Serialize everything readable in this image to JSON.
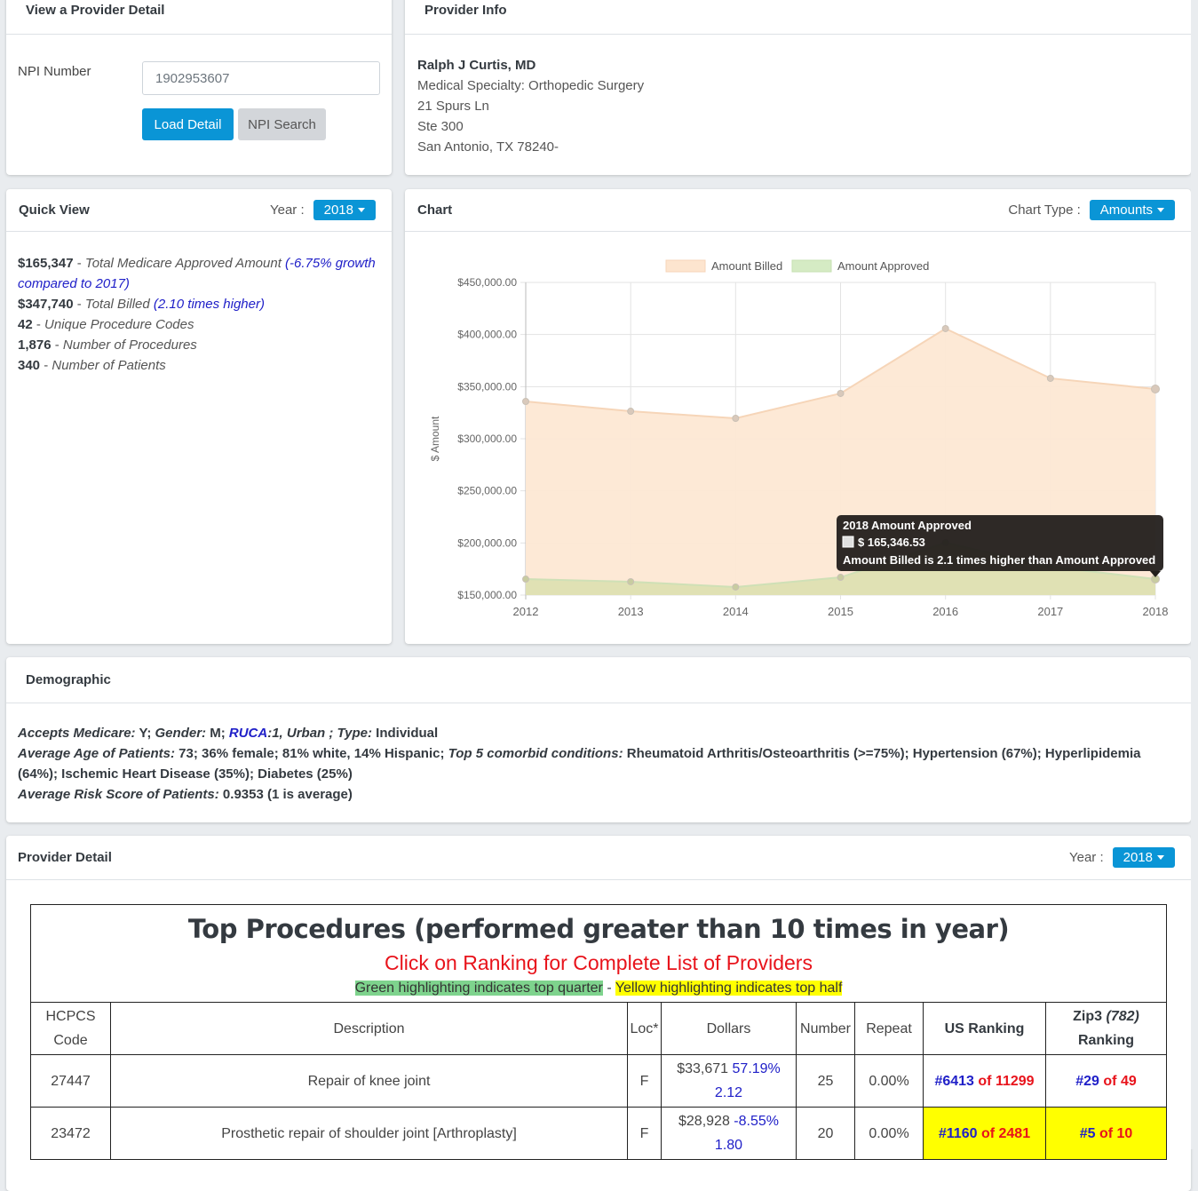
{
  "view_provider": {
    "title": "View a Provider Detail",
    "npi_label": "NPI Number",
    "npi_value": "1902953607",
    "load_button": "Load Detail",
    "npi_search_button": "NPI Search"
  },
  "provider_info": {
    "title": "Provider Info",
    "name": "Ralph J Curtis, MD",
    "specialty": "Medical Specialty: Orthopedic Surgery",
    "address1": "21 Spurs Ln",
    "address2": "Ste 300",
    "city_state_zip": "San Antonio, TX 78240-"
  },
  "quick_view": {
    "title": "Quick View",
    "year_label": "Year :",
    "year_value": "2018",
    "items": [
      {
        "value": "$165,347",
        "sep": " - ",
        "label": "Total Medicare Approved Amount",
        "note": " (-6.75% growth compared to 2017)"
      },
      {
        "value": "$347,740",
        "sep": " - ",
        "label": "Total Billed",
        "note": " (2.10 times higher)"
      },
      {
        "value": "42",
        "sep": " - ",
        "label": "Unique Procedure Codes",
        "note": ""
      },
      {
        "value": "1,876",
        "sep": " - ",
        "label": "Number of Procedures",
        "note": ""
      },
      {
        "value": "340",
        "sep": " - ",
        "label": "Number of Patients",
        "note": ""
      }
    ]
  },
  "chart_card": {
    "title": "Chart",
    "type_label": "Chart Type :",
    "type_value": "Amounts",
    "tooltip": {
      "title": "2018 Amount Approved",
      "value": "$ 165,346.53",
      "footer": "Amount Billed is 2.1 times higher than Amount Approved"
    }
  },
  "chart_data": {
    "type": "area",
    "title": "",
    "xlabel": "",
    "ylabel": "$ Amount",
    "x": [
      "2012",
      "2013",
      "2014",
      "2015",
      "2016",
      "2017",
      "2018"
    ],
    "ylim": [
      150000,
      450000
    ],
    "yticks": [
      150000,
      200000,
      250000,
      300000,
      350000,
      400000,
      450000
    ],
    "ytick_labels": [
      "$150,000.00",
      "$200,000.00",
      "$250,000.00",
      "$300,000.00",
      "$350,000.00",
      "$400,000.00",
      "$450,000.00"
    ],
    "grid": true,
    "legend_position": "top-center",
    "series": [
      {
        "name": "Amount Billed",
        "color": "#fde5cf",
        "values": [
          335800,
          326400,
          319600,
          343500,
          405700,
          358000,
          347740
        ]
      },
      {
        "name": "Amount Approved",
        "color": "#d5ebc4",
        "values": [
          165300,
          162800,
          157700,
          167000,
          200300,
          177300,
          165346.53
        ]
      }
    ]
  },
  "demographic": {
    "title": "Demographic",
    "line1": [
      {
        "t": "Accepts Medicare:",
        "s": "i"
      },
      {
        "t": " Y; ",
        "s": "b"
      },
      {
        "t": "Gender:",
        "s": "i"
      },
      {
        "t": " M; ",
        "s": "b"
      },
      {
        "t": "RUCA",
        "s": "ruca"
      },
      {
        "t": ":1, Urban ; ",
        "s": "i"
      },
      {
        "t": "Type:",
        "s": "i"
      },
      {
        "t": " Individual",
        "s": "b"
      }
    ],
    "line2": [
      {
        "t": "Average Age of Patients:",
        "s": "i"
      },
      {
        "t": " 73; 36% female; 81% white, 14% Hispanic; ",
        "s": "b"
      },
      {
        "t": "Top 5 comorbid conditions:",
        "s": "i"
      },
      {
        "t": " Rheumatoid Arthritis/Osteoarthritis (>=75%); Hypertension (67%); Hyperlipidemia (64%); Ischemic Heart Disease (35%); Diabetes (25%)",
        "s": "b"
      }
    ],
    "line3": [
      {
        "t": "Average Risk Score of Patients:",
        "s": "i"
      },
      {
        "t": " 0.9353 (1 is average)",
        "s": "b"
      }
    ]
  },
  "provider_detail": {
    "title": "Provider Detail",
    "year_label": "Year :",
    "year_value": "2018",
    "table_title": "Top Procedures (performed greater than 10 times in year)",
    "table_subtitle": "Click on Ranking for Complete List of Providers",
    "legend_green": "Green highlighting indicates top quarter",
    "legend_sep": " - ",
    "legend_yellow": "Yellow highlighting indicates top half",
    "columns": {
      "code": "HCPCS Code",
      "description": "Description",
      "loc": "Loc*",
      "dollars": "Dollars",
      "number": "Number",
      "repeat": "Repeat",
      "us_ranking": "US Ranking",
      "zip3_prefix": "Zip3 ",
      "zip3_code": "(782)",
      "zip3_suffix": "Ranking"
    },
    "rows": [
      {
        "code": "27447",
        "description": "Repair of knee joint",
        "loc": "F",
        "dollars": "$33,671",
        "growth": "57.19%",
        "ratio": "2.12",
        "number": "25",
        "repeat": "0.00%",
        "us_rank": "#6413",
        "us_of": "of 11299",
        "us_highlight": "none",
        "zip_rank": "#29",
        "zip_of": "of 49",
        "zip_highlight": "none"
      },
      {
        "code": "23472",
        "description": "Prosthetic repair of shoulder joint [Arthroplasty]",
        "loc": "F",
        "dollars": "$28,928",
        "growth": "-8.55%",
        "ratio": "1.80",
        "number": "20",
        "repeat": "0.00%",
        "us_rank": "#1160",
        "us_of": "of 2481",
        "us_highlight": "yellow",
        "zip_rank": "#5",
        "zip_of": "of 10",
        "zip_highlight": "yellow"
      }
    ]
  }
}
